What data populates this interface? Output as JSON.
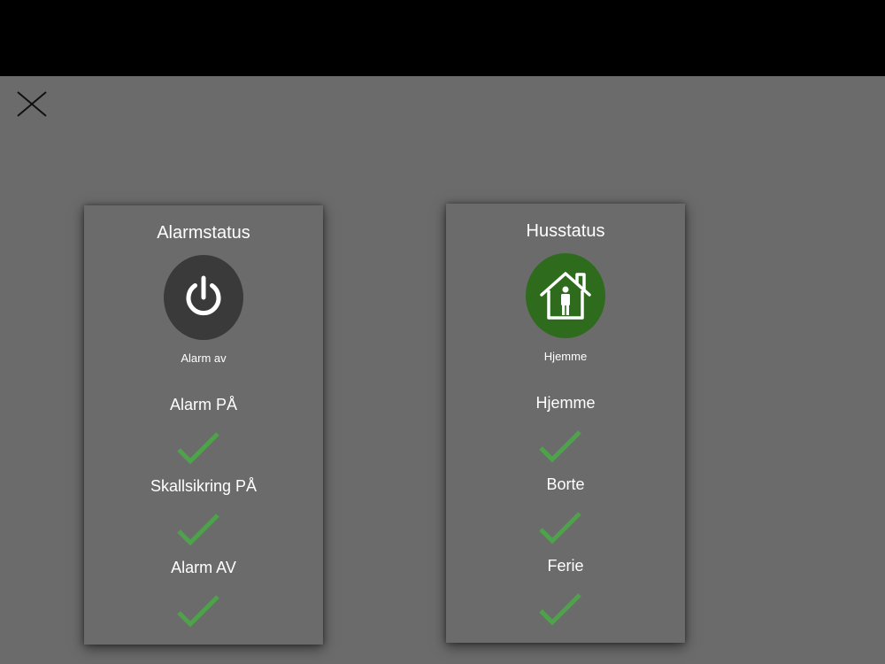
{
  "colors": {
    "background": "#6b6b6b",
    "top_bar": "#000000",
    "alarm_icon_bg": "#3a3a3a",
    "house_icon_bg": "#2e6b1d",
    "check": "#4ea24a"
  },
  "close_icon": "close-icon",
  "alarm_card": {
    "title": "Alarmstatus",
    "icon": "power-icon",
    "status": "Alarm av",
    "options": [
      {
        "label": "Alarm PÅ",
        "selected": true
      },
      {
        "label": "Skallsikring PÅ",
        "selected": true
      },
      {
        "label": "Alarm AV",
        "selected": true
      }
    ]
  },
  "house_card": {
    "title": "Husstatus",
    "icon": "house-person-icon",
    "status": "Hjemme",
    "options": [
      {
        "label": "Hjemme",
        "selected": true
      },
      {
        "label": "Borte",
        "selected": true
      },
      {
        "label": "Ferie",
        "selected": true
      }
    ]
  }
}
